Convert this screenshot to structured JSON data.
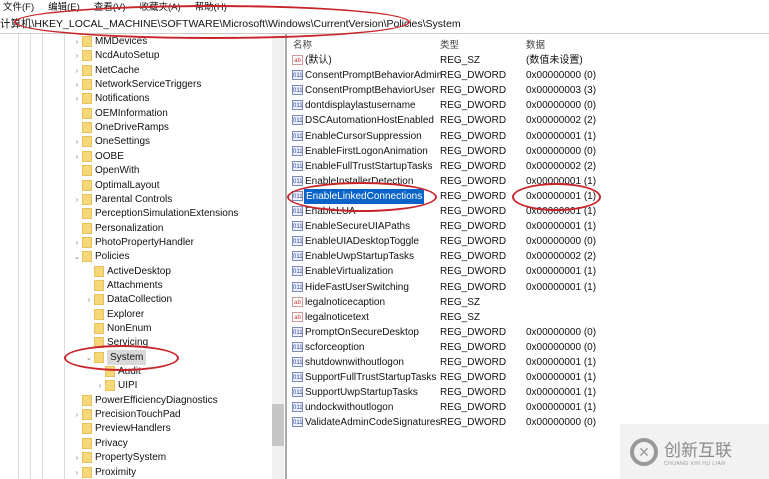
{
  "menu": [
    "文件(F)",
    "编辑(E)",
    "查看(V)",
    "收藏夹(A)",
    "帮助(H)"
  ],
  "address": "计算机\\HKEY_LOCAL_MACHINE\\SOFTWARE\\Microsoft\\Windows\\CurrentVersion\\Policies\\System",
  "tree": [
    {
      "label": "MMDevices",
      "level": 1,
      "arrow": ">"
    },
    {
      "label": "NcdAutoSetup",
      "level": 1,
      "arrow": ">"
    },
    {
      "label": "NetCache",
      "level": 1,
      "arrow": ">"
    },
    {
      "label": "NetworkServiceTriggers",
      "level": 1,
      "arrow": ">"
    },
    {
      "label": "Notifications",
      "level": 1,
      "arrow": ">"
    },
    {
      "label": "OEMInformation",
      "level": 1,
      "arrow": ""
    },
    {
      "label": "OneDriveRamps",
      "level": 1,
      "arrow": ""
    },
    {
      "label": "OneSettings",
      "level": 1,
      "arrow": ">"
    },
    {
      "label": "OOBE",
      "level": 1,
      "arrow": ">"
    },
    {
      "label": "OpenWith",
      "level": 1,
      "arrow": ""
    },
    {
      "label": "OptimalLayout",
      "level": 1,
      "arrow": ""
    },
    {
      "label": "Parental Controls",
      "level": 1,
      "arrow": ">"
    },
    {
      "label": "PerceptionSimulationExtensions",
      "level": 1,
      "arrow": ""
    },
    {
      "label": "Personalization",
      "level": 1,
      "arrow": ""
    },
    {
      "label": "PhotoPropertyHandler",
      "level": 1,
      "arrow": ">"
    },
    {
      "label": "Policies",
      "level": 1,
      "arrow": "v"
    },
    {
      "label": "ActiveDesktop",
      "level": 2,
      "arrow": ""
    },
    {
      "label": "Attachments",
      "level": 2,
      "arrow": ""
    },
    {
      "label": "DataCollection",
      "level": 2,
      "arrow": ">"
    },
    {
      "label": "Explorer",
      "level": 2,
      "arrow": ""
    },
    {
      "label": "NonEnum",
      "level": 2,
      "arrow": ""
    },
    {
      "label": "Servicing",
      "level": 2,
      "arrow": ""
    },
    {
      "label": "System",
      "level": 2,
      "arrow": "v",
      "selected": true
    },
    {
      "label": "Audit",
      "level": 3,
      "arrow": ""
    },
    {
      "label": "UIPI",
      "level": 3,
      "arrow": ">"
    },
    {
      "label": "PowerEfficiencyDiagnostics",
      "level": 1,
      "arrow": ""
    },
    {
      "label": "PrecisionTouchPad",
      "level": 1,
      "arrow": ">"
    },
    {
      "label": "PreviewHandlers",
      "level": 1,
      "arrow": ""
    },
    {
      "label": "Privacy",
      "level": 1,
      "arrow": ""
    },
    {
      "label": "PropertySystem",
      "level": 1,
      "arrow": ">"
    },
    {
      "label": "Proximity",
      "level": 1,
      "arrow": ">"
    }
  ],
  "columns": {
    "name": "名称",
    "type": "类型",
    "data": "数据"
  },
  "values": [
    {
      "name": "(默认)",
      "type": "REG_SZ",
      "data": "(数值未设置)",
      "icon": "string-value-icon"
    },
    {
      "name": "ConsentPromptBehaviorAdmin",
      "type": "REG_DWORD",
      "data": "0x00000000 (0)",
      "icon": "dword-value-icon"
    },
    {
      "name": "ConsentPromptBehaviorUser",
      "type": "REG_DWORD",
      "data": "0x00000003 (3)",
      "icon": "dword-value-icon"
    },
    {
      "name": "dontdisplaylastusername",
      "type": "REG_DWORD",
      "data": "0x00000000 (0)",
      "icon": "dword-value-icon"
    },
    {
      "name": "DSCAutomationHostEnabled",
      "type": "REG_DWORD",
      "data": "0x00000002 (2)",
      "icon": "dword-value-icon"
    },
    {
      "name": "EnableCursorSuppression",
      "type": "REG_DWORD",
      "data": "0x00000001 (1)",
      "icon": "dword-value-icon"
    },
    {
      "name": "EnableFirstLogonAnimation",
      "type": "REG_DWORD",
      "data": "0x00000000 (0)",
      "icon": "dword-value-icon"
    },
    {
      "name": "EnableFullTrustStartupTasks",
      "type": "REG_DWORD",
      "data": "0x00000002 (2)",
      "icon": "dword-value-icon"
    },
    {
      "name": "EnableInstallerDetection",
      "type": "REG_DWORD",
      "data": "0x00000001 (1)",
      "icon": "dword-value-icon"
    },
    {
      "name": "EnableLinkedConnections",
      "type": "REG_DWORD",
      "data": "0x00000001 (1)",
      "icon": "dword-value-icon",
      "selected": true
    },
    {
      "name": "EnableLUA",
      "type": "REG_DWORD",
      "data": "0x00000001 (1)",
      "icon": "dword-value-icon"
    },
    {
      "name": "EnableSecureUIAPaths",
      "type": "REG_DWORD",
      "data": "0x00000001 (1)",
      "icon": "dword-value-icon"
    },
    {
      "name": "EnableUIADesktopToggle",
      "type": "REG_DWORD",
      "data": "0x00000000 (0)",
      "icon": "dword-value-icon"
    },
    {
      "name": "EnableUwpStartupTasks",
      "type": "REG_DWORD",
      "data": "0x00000002 (2)",
      "icon": "dword-value-icon"
    },
    {
      "name": "EnableVirtualization",
      "type": "REG_DWORD",
      "data": "0x00000001 (1)",
      "icon": "dword-value-icon"
    },
    {
      "name": "HideFastUserSwitching",
      "type": "REG_DWORD",
      "data": "0x00000001 (1)",
      "icon": "dword-value-icon"
    },
    {
      "name": "legalnoticecaption",
      "type": "REG_SZ",
      "data": "",
      "icon": "string-value-icon"
    },
    {
      "name": "legalnoticetext",
      "type": "REG_SZ",
      "data": "",
      "icon": "string-value-icon"
    },
    {
      "name": "PromptOnSecureDesktop",
      "type": "REG_DWORD",
      "data": "0x00000000 (0)",
      "icon": "dword-value-icon"
    },
    {
      "name": "scforceoption",
      "type": "REG_DWORD",
      "data": "0x00000000 (0)",
      "icon": "dword-value-icon"
    },
    {
      "name": "shutdownwithoutlogon",
      "type": "REG_DWORD",
      "data": "0x00000001 (1)",
      "icon": "dword-value-icon"
    },
    {
      "name": "SupportFullTrustStartupTasks",
      "type": "REG_DWORD",
      "data": "0x00000001 (1)",
      "icon": "dword-value-icon"
    },
    {
      "name": "SupportUwpStartupTasks",
      "type": "REG_DWORD",
      "data": "0x00000001 (1)",
      "icon": "dword-value-icon"
    },
    {
      "name": "undockwithoutlogon",
      "type": "REG_DWORD",
      "data": "0x00000001 (1)",
      "icon": "dword-value-icon"
    },
    {
      "name": "ValidateAdminCodeSignatures",
      "type": "REG_DWORD",
      "data": "0x00000000 (0)",
      "icon": "dword-value-icon"
    }
  ],
  "watermark": {
    "text": "创新互联",
    "sub": "CHUANG XIN HU LIAN"
  },
  "colors": {
    "highlight": "#0a64c8",
    "annotation": "#c8252a",
    "folder": "#f6d77a"
  }
}
